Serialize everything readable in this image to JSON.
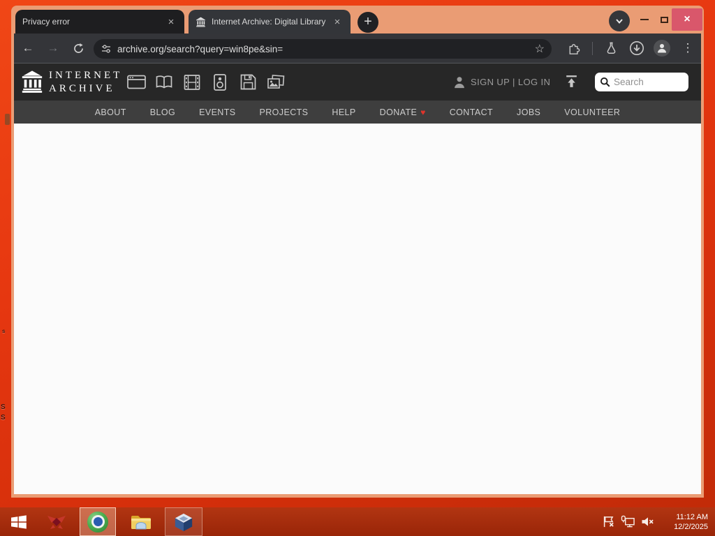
{
  "icons": {
    "close": "×",
    "plus": "+",
    "kebab": "⋮",
    "back": "←",
    "forward": "→",
    "star": "☆"
  },
  "browser": {
    "tabs": [
      {
        "title": "Privacy error"
      },
      {
        "title": "Internet Archive: Digital Library"
      }
    ],
    "url": "archive.org/search?query=win8pe&sin="
  },
  "page": {
    "header": {
      "wordmark_line1": "INTERNET",
      "wordmark_line2": "ARCHIVE",
      "auth_label": "SIGN UP | LOG IN",
      "search_placeholder": "Search",
      "media_types": [
        "web",
        "texts",
        "video",
        "audio",
        "software",
        "images"
      ]
    },
    "nav": {
      "items": [
        {
          "label": "ABOUT"
        },
        {
          "label": "BLOG"
        },
        {
          "label": "EVENTS"
        },
        {
          "label": "PROJECTS"
        },
        {
          "label": "HELP"
        },
        {
          "label": "DONATE"
        },
        {
          "label": "CONTACT"
        },
        {
          "label": "JOBS"
        },
        {
          "label": "VOLUNTEER"
        }
      ],
      "donate_heart": "♥"
    }
  },
  "taskbar": {
    "time": "11:12 AM",
    "date": "12/2/2025"
  },
  "desktop": {
    "fragments": [
      "s",
      "S",
      "S"
    ]
  },
  "colors": {
    "desktop": "#e63710",
    "window_frame": "#ea9c74",
    "browser_chrome": "#343539",
    "archive_header": "#272727",
    "archive_nav": "#3e3e3e",
    "taskbar": "#a82c0f",
    "close_button": "#d9576b",
    "heart_red": "#e0342b"
  }
}
